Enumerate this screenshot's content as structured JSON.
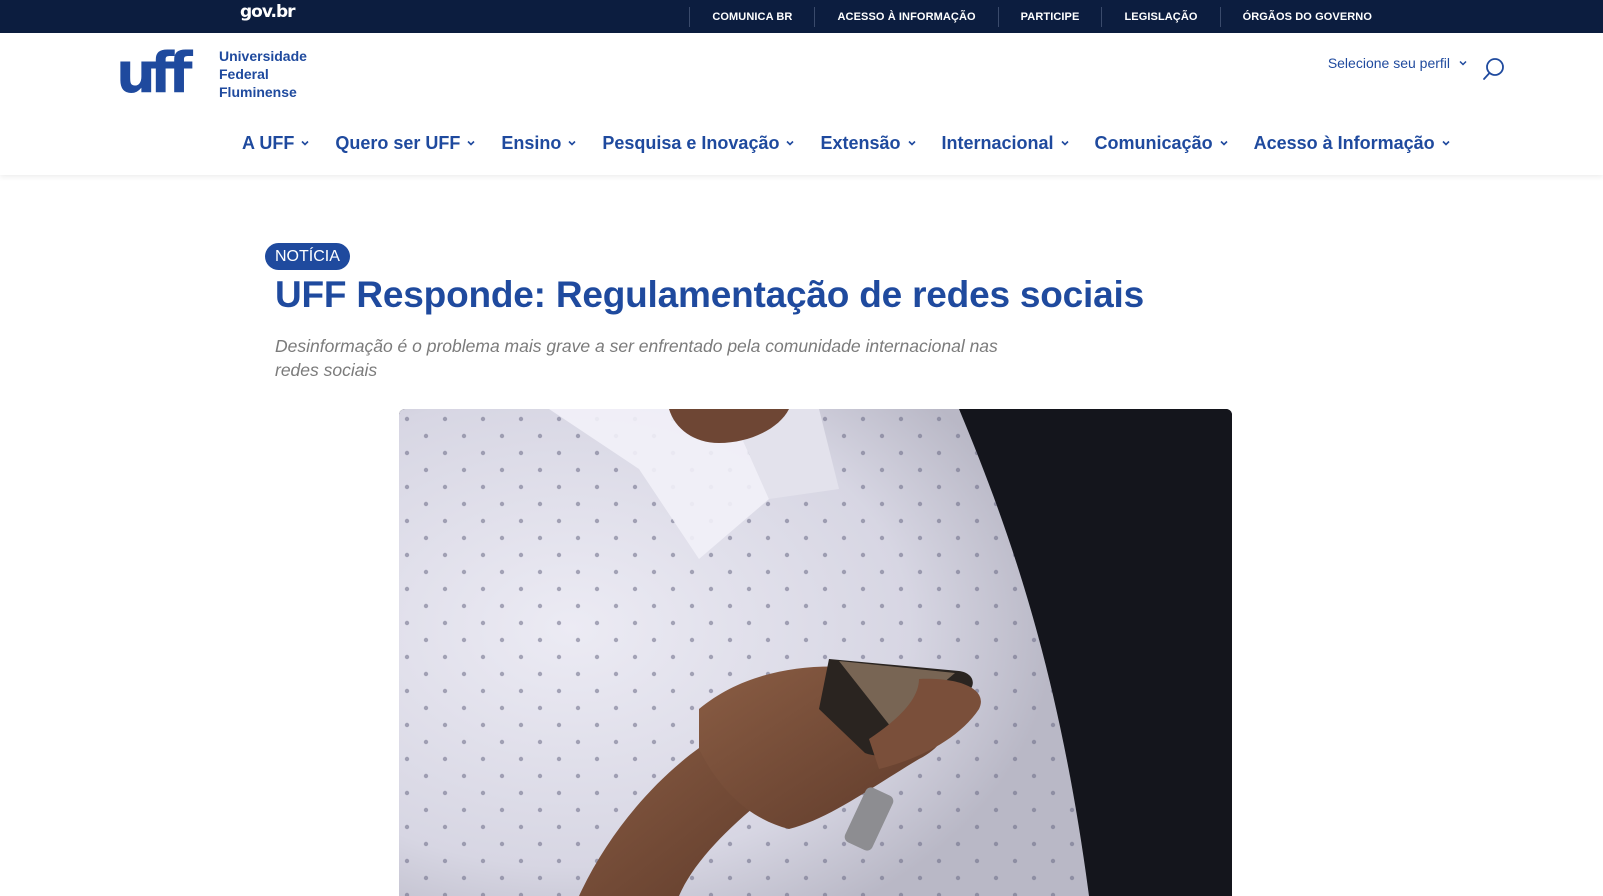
{
  "govbar": {
    "logo": "gov.br",
    "links": [
      {
        "label": "COMUNICA BR"
      },
      {
        "label": "ACESSO À INFORMAÇÃO"
      },
      {
        "label": "PARTICIPE"
      },
      {
        "label": "LEGISLAÇÃO"
      },
      {
        "label": "ÓRGÃOS DO GOVERNO"
      }
    ]
  },
  "header": {
    "brand": {
      "logo_text": "uff",
      "line1": "Universidade",
      "line2": "Federal",
      "line3": "Fluminense"
    },
    "profile_label": "Selecione seu perfil"
  },
  "nav": {
    "items": [
      {
        "label": "A UFF"
      },
      {
        "label": "Quero ser UFF"
      },
      {
        "label": "Ensino"
      },
      {
        "label": "Pesquisa e Inovação"
      },
      {
        "label": "Extensão"
      },
      {
        "label": "Internacional"
      },
      {
        "label": "Comunicação"
      },
      {
        "label": "Acesso à Informação"
      }
    ]
  },
  "article": {
    "badge": "NOTÍCIA",
    "title": "UFF Responde: Regulamentação de redes sociais",
    "subtitle": "Desinformação é o problema mais grave a ser enfrentado pela comunidade internacional nas redes sociais"
  },
  "colors": {
    "brand_blue": "#1f4a9e",
    "govbar_bg": "#0c1d3f",
    "subtitle_gray": "#7b7b7b"
  },
  "icons": {
    "search": "search-icon",
    "chevron": "chevron-down-icon"
  }
}
